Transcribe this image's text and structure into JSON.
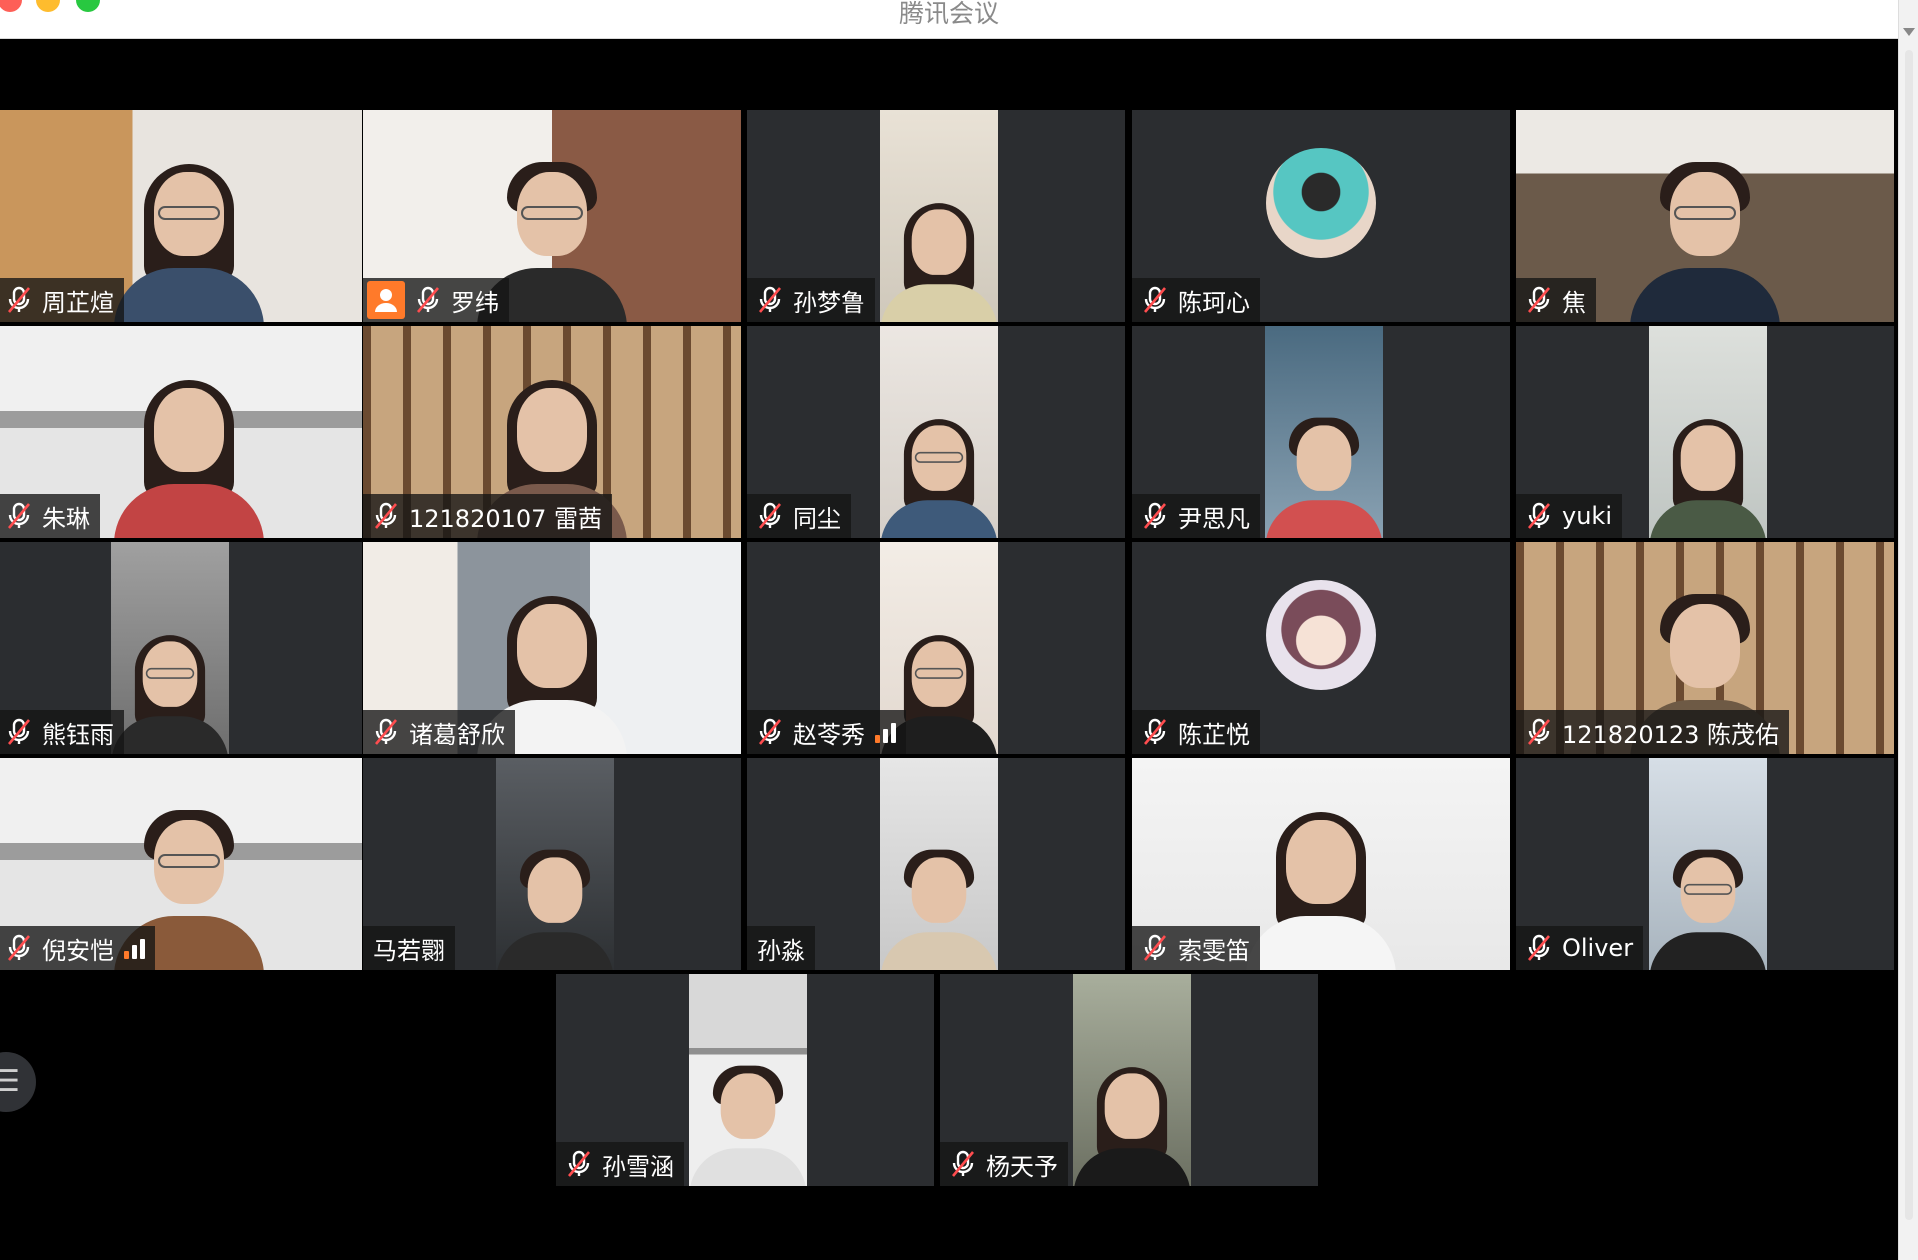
{
  "window": {
    "title": "腾讯会议",
    "traffic_colors": [
      "#fe5f57",
      "#febc2e",
      "#28c840"
    ]
  },
  "participants": [
    {
      "name": "周芷煊",
      "muted": true,
      "signal": false,
      "host": false
    },
    {
      "name": "罗纬",
      "muted": true,
      "signal": false,
      "host": true
    },
    {
      "name": "孙梦鲁",
      "muted": true,
      "signal": false,
      "host": false
    },
    {
      "name": "陈珂心",
      "muted": true,
      "signal": false,
      "host": false,
      "avatar": true
    },
    {
      "name": "焦",
      "muted": true,
      "signal": false,
      "host": false
    },
    {
      "name": "朱琳",
      "muted": true,
      "signal": false,
      "host": false
    },
    {
      "name": "121820107 雷茜",
      "muted": true,
      "signal": false,
      "host": false
    },
    {
      "name": "同尘",
      "muted": true,
      "signal": false,
      "host": false
    },
    {
      "name": "尹思凡",
      "muted": true,
      "signal": false,
      "host": false
    },
    {
      "name": "yuki",
      "muted": true,
      "signal": false,
      "host": false
    },
    {
      "name": "熊钰雨",
      "muted": true,
      "signal": false,
      "host": false
    },
    {
      "name": "诸葛舒欣",
      "muted": true,
      "signal": false,
      "host": false
    },
    {
      "name": "赵苓秀",
      "muted": true,
      "signal": true,
      "host": false
    },
    {
      "name": "陈芷悦",
      "muted": true,
      "signal": false,
      "host": false,
      "avatar": true
    },
    {
      "name": "121820123 陈茂佑",
      "muted": true,
      "signal": false,
      "host": false
    },
    {
      "name": "倪安恺",
      "muted": true,
      "signal": true,
      "host": false
    },
    {
      "name": "马若翾",
      "muted": false,
      "signal": false,
      "host": false
    },
    {
      "name": "孙淼",
      "muted": false,
      "signal": false,
      "host": false
    },
    {
      "name": "索雯笛",
      "muted": true,
      "signal": false,
      "host": false
    },
    {
      "name": "Oliver",
      "muted": true,
      "signal": false,
      "host": false
    },
    {
      "name": "孙雪涵",
      "muted": true,
      "signal": false,
      "host": false
    },
    {
      "name": "杨天予",
      "muted": true,
      "signal": false,
      "host": false
    }
  ],
  "controls": {
    "menu_icon": "list-icon",
    "menu_glyph": "☰"
  }
}
